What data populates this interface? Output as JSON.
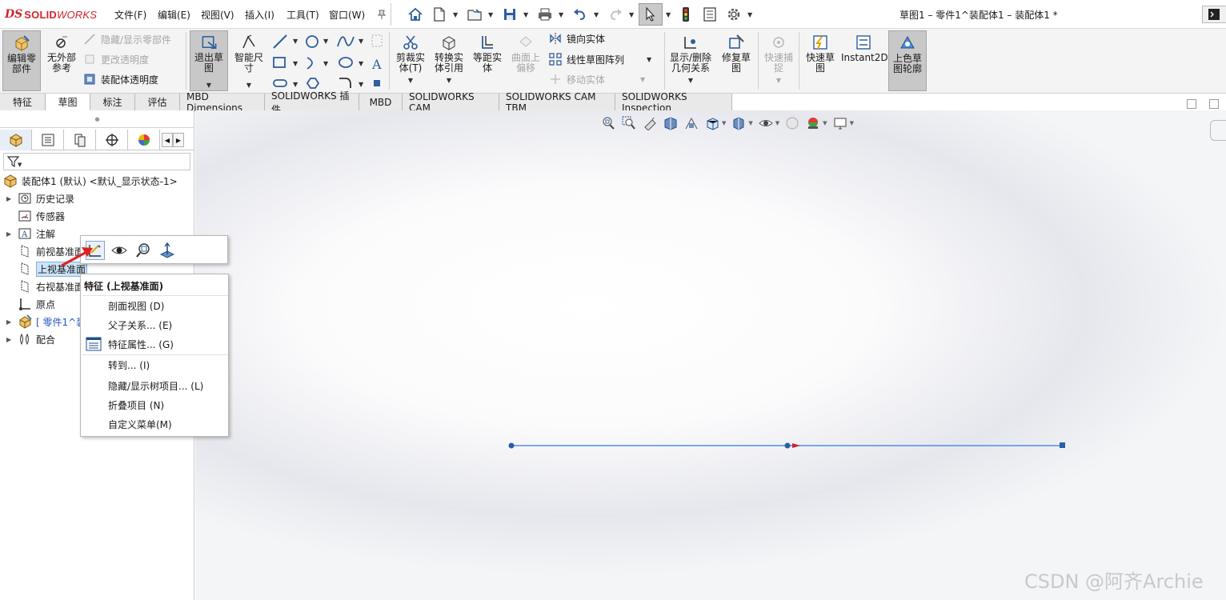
{
  "app": {
    "logo_ds": "DS",
    "logo_text_bold": "SOLID",
    "logo_text_italic": "WORKS",
    "document_title": "草图1 – 零件1^装配体1 – 装配体1 *"
  },
  "menu": {
    "file": "文件(F)",
    "edit": "编辑(E)",
    "view": "视图(V)",
    "insert": "插入(I)",
    "tools": "工具(T)",
    "window": "窗口(W)"
  },
  "command_manager": {
    "edit_component": "编辑零部件",
    "no_external_refs": "无外部参考",
    "hide_show_components": "隐藏/显示零部件",
    "change_transparency": "更改透明度",
    "assembly_transparency": "装配体透明度",
    "exit_sketch": "退出草图",
    "smart_dimension": "智能尺寸",
    "trim_entities": "剪裁实体(T)",
    "convert_entities": "转换实体引用",
    "offset_entities": "等距实体",
    "offset_on_surface": "曲面上偏移",
    "mirror_entities": "镜向实体",
    "linear_pattern": "线性草图阵列",
    "move_entities": "移动实体",
    "display_delete_relations": "显示/删除几何关系",
    "repair_sketch": "修复草图",
    "quick_snaps": "快速捕捉",
    "rapid_sketch": "快速草图",
    "instant2d": "Instant2D",
    "shaded_sketch_contours": "上色草图轮廓"
  },
  "tabs": [
    "特征",
    "草图",
    "标注",
    "评估",
    "MBD Dimensions",
    "SOLIDWORKS 插件",
    "MBD",
    "SOLIDWORKS CAM",
    "SOLIDWORKS CAM TBM",
    "SOLIDWORKS Inspection"
  ],
  "active_tab_index": 1,
  "feature_tree": {
    "root": "装配体1 (默认) <默认_显示状态-1>",
    "items": [
      {
        "label": "历史记录",
        "icon": "history-icon"
      },
      {
        "label": "传感器",
        "icon": "sensor-icon"
      },
      {
        "label": "注解",
        "icon": "annotation-icon"
      },
      {
        "label": "前视基准面",
        "icon": "plane-icon"
      },
      {
        "label": "上视基准面",
        "icon": "plane-icon"
      },
      {
        "label": "右视基准面",
        "icon": "plane-icon"
      },
      {
        "label": "原点",
        "icon": "origin-icon"
      },
      {
        "label": "[ 零件1^装",
        "icon": "part-icon"
      },
      {
        "label": "配合",
        "icon": "mates-icon"
      }
    ],
    "selected_index": 4
  },
  "context_menu": {
    "header": "特征 (上视基准面)",
    "items": [
      "剖面视图 (D)",
      "父子关系... (E)",
      "特征属性... (G)",
      "转到... (I)",
      "隐藏/显示树项目... (L)",
      "折叠项目 (N)",
      "自定义菜单(M)"
    ]
  },
  "colors": {
    "brand_red": "#d2232a",
    "sketch_line": "#4a90e2",
    "sketch_point": "#2a5ea8",
    "midpoint_marker": "#d0202a",
    "selection": "#cde3f8"
  },
  "watermark": "CSDN @阿齐Archie"
}
